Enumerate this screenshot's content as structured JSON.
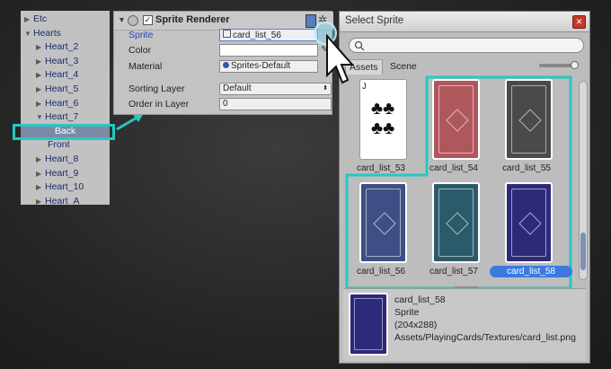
{
  "hierarchy": {
    "items": [
      {
        "label": "Etc",
        "arrow": "▶",
        "indent": 0
      },
      {
        "label": "Hearts",
        "arrow": "▼",
        "indent": 0
      },
      {
        "label": "Heart_2",
        "arrow": "▶",
        "indent": 1
      },
      {
        "label": "Heart_3",
        "arrow": "▶",
        "indent": 1
      },
      {
        "label": "Heart_4",
        "arrow": "▶",
        "indent": 1
      },
      {
        "label": "Heart_5",
        "arrow": "▶",
        "indent": 1
      },
      {
        "label": "Heart_6",
        "arrow": "▶",
        "indent": 1
      },
      {
        "label": "Heart_7",
        "arrow": "▼",
        "indent": 1
      },
      {
        "label": "Back",
        "arrow": "",
        "indent": 2,
        "selected": true
      },
      {
        "label": "Front",
        "arrow": "",
        "indent": 2
      },
      {
        "label": "Heart_8",
        "arrow": "▶",
        "indent": 1
      },
      {
        "label": "Heart_9",
        "arrow": "▶",
        "indent": 1
      },
      {
        "label": "Heart_10",
        "arrow": "▶",
        "indent": 1
      },
      {
        "label": "Heart_A",
        "arrow": "▶",
        "indent": 1
      }
    ]
  },
  "inspector": {
    "component_title": "Sprite Renderer",
    "sprite_label": "Sprite",
    "sprite_value": "card_list_56",
    "color_label": "Color",
    "material_label": "Material",
    "material_value": "Sprites-Default",
    "sorting_layer_label": "Sorting Layer",
    "sorting_layer_value": "Default",
    "order_label": "Order in Layer",
    "order_value": "0"
  },
  "select_sprite": {
    "title": "Select Sprite",
    "tab_assets": "Assets",
    "tab_scene": "Scene",
    "cards": [
      {
        "name": "card_list_53",
        "color": "#ffffff",
        "kind": "face"
      },
      {
        "name": "card_list_54",
        "color": "#b0575d",
        "kind": "back"
      },
      {
        "name": "card_list_55",
        "color": "#4a4a4a",
        "kind": "back"
      },
      {
        "name": "card_list_56",
        "color": "#3e4f86",
        "kind": "back"
      },
      {
        "name": "card_list_57",
        "color": "#2b5b6a",
        "kind": "back"
      },
      {
        "name": "card_list_58",
        "color": "#2d2a7a",
        "kind": "back",
        "selected": true
      }
    ],
    "preview": {
      "name": "card_list_58",
      "type": "Sprite",
      "size": "(204x288)",
      "path": "Assets/PlayingCards/Textures/card_list.png"
    }
  },
  "colors": {
    "highlight": "#25c9c1",
    "selection": "#3a7ae0"
  }
}
